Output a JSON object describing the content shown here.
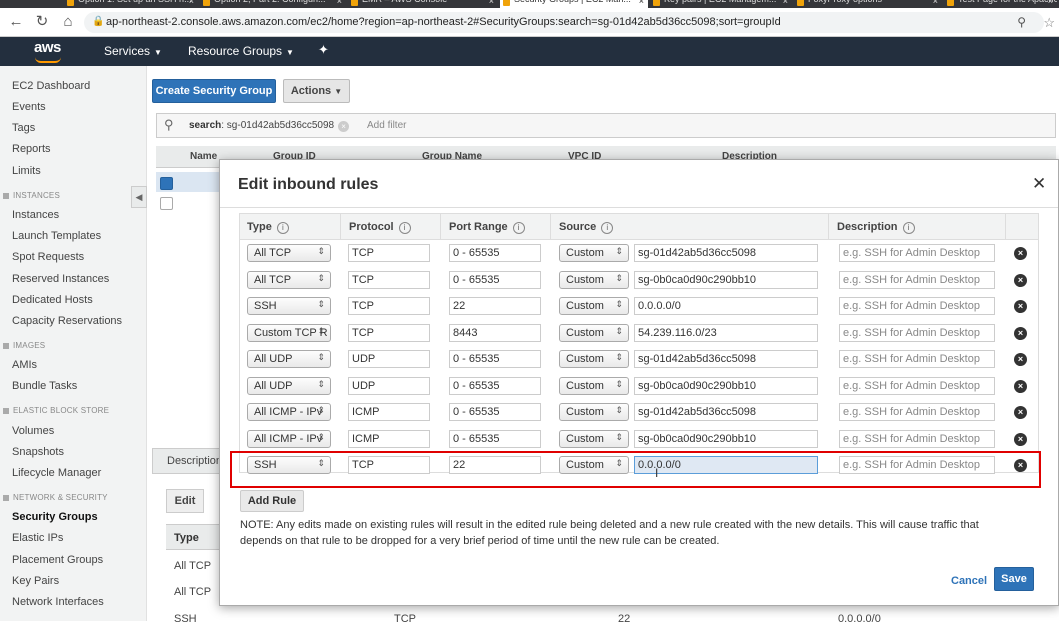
{
  "browser": {
    "tabs": [
      {
        "label": "Option 1: Set up an SSH h...",
        "active": false
      },
      {
        "label": "Option 2, Part 2: Configuri...",
        "active": false
      },
      {
        "label": "EMR – AWS Console",
        "active": false
      },
      {
        "label": "Security Groups | EC2 Man...",
        "active": true
      },
      {
        "label": "Key pairs | EC2 Managem...",
        "active": false
      },
      {
        "label": "FoxyProxy options",
        "active": false
      },
      {
        "label": "Test Page for the Apache",
        "active": false
      }
    ],
    "url": "ap-northeast-2.console.aws.amazon.com/ec2/home?region=ap-northeast-2#SecurityGroups:search=sg-01d42ab5d36cc5098;sort=groupId"
  },
  "aws_nav": {
    "logo": "aws",
    "services": "Services",
    "resource_groups": "Resource Groups"
  },
  "sidebar": {
    "items": [
      {
        "label": "EC2 Dashboard",
        "type": "item"
      },
      {
        "label": "Events",
        "type": "item"
      },
      {
        "label": "Tags",
        "type": "item"
      },
      {
        "label": "Reports",
        "type": "item"
      },
      {
        "label": "Limits",
        "type": "item"
      },
      {
        "label": "INSTANCES",
        "type": "head"
      },
      {
        "label": "Instances",
        "type": "item"
      },
      {
        "label": "Launch Templates",
        "type": "item"
      },
      {
        "label": "Spot Requests",
        "type": "item"
      },
      {
        "label": "Reserved Instances",
        "type": "item"
      },
      {
        "label": "Dedicated Hosts",
        "type": "item"
      },
      {
        "label": "Capacity Reservations",
        "type": "item"
      },
      {
        "label": "IMAGES",
        "type": "head"
      },
      {
        "label": "AMIs",
        "type": "item"
      },
      {
        "label": "Bundle Tasks",
        "type": "item"
      },
      {
        "label": "ELASTIC BLOCK STORE",
        "type": "head"
      },
      {
        "label": "Volumes",
        "type": "item"
      },
      {
        "label": "Snapshots",
        "type": "item"
      },
      {
        "label": "Lifecycle Manager",
        "type": "item"
      },
      {
        "label": "NETWORK & SECURITY",
        "type": "head"
      },
      {
        "label": "Security Groups",
        "type": "item",
        "active": true
      },
      {
        "label": "Elastic IPs",
        "type": "item"
      },
      {
        "label": "Placement Groups",
        "type": "item"
      },
      {
        "label": "Key Pairs",
        "type": "item"
      },
      {
        "label": "Network Interfaces",
        "type": "item"
      }
    ]
  },
  "main": {
    "create_button": "Create Security Group",
    "actions_button": "Actions",
    "search_token_key": "search",
    "search_token_value": ": sg-01d42ab5d36cc5098",
    "add_filter": "Add filter",
    "columns": [
      "Name",
      "Group ID",
      "Group Name",
      "VPC ID",
      "Description"
    ],
    "description_tab": "Description",
    "edit_button": "Edit",
    "lower_type_header": "Type",
    "lower_rows": [
      {
        "type": "All TCP"
      },
      {
        "type": "All TCP"
      },
      {
        "type": "SSH",
        "protocol": "TCP",
        "port": "22",
        "source": "0.0.0.0/0"
      }
    ]
  },
  "modal": {
    "title": "Edit inbound rules",
    "columns": {
      "type": "Type",
      "protocol": "Protocol",
      "port_range": "Port Range",
      "source": "Source",
      "description": "Description"
    },
    "rules": [
      {
        "type": "All TCP",
        "protocol": "TCP",
        "port": "0 - 65535",
        "source_type": "Custom",
        "source": "sg-01d42ab5d36cc5098",
        "description_placeholder": "e.g. SSH for Admin Desktop"
      },
      {
        "type": "All TCP",
        "protocol": "TCP",
        "port": "0 - 65535",
        "source_type": "Custom",
        "source": "sg-0b0ca0d90c290bb10",
        "description_placeholder": "e.g. SSH for Admin Desktop"
      },
      {
        "type": "SSH",
        "protocol": "TCP",
        "port": "22",
        "source_type": "Custom",
        "source": "0.0.0.0/0",
        "description_placeholder": "e.g. SSH for Admin Desktop"
      },
      {
        "type": "Custom TCP R",
        "protocol": "TCP",
        "port": "8443",
        "source_type": "Custom",
        "source": "54.239.116.0/23",
        "description_placeholder": "e.g. SSH for Admin Desktop"
      },
      {
        "type": "All UDP",
        "protocol": "UDP",
        "port": "0 - 65535",
        "source_type": "Custom",
        "source": "sg-01d42ab5d36cc5098",
        "description_placeholder": "e.g. SSH for Admin Desktop"
      },
      {
        "type": "All UDP",
        "protocol": "UDP",
        "port": "0 - 65535",
        "source_type": "Custom",
        "source": "sg-0b0ca0d90c290bb10",
        "description_placeholder": "e.g. SSH for Admin Desktop"
      },
      {
        "type": "All ICMP - IPv",
        "protocol": "ICMP",
        "port": "0 - 65535",
        "source_type": "Custom",
        "source": "sg-01d42ab5d36cc5098",
        "description_placeholder": "e.g. SSH for Admin Desktop"
      },
      {
        "type": "All ICMP - IPv",
        "protocol": "ICMP",
        "port": "0 - 65535",
        "source_type": "Custom",
        "source": "sg-0b0ca0d90c290bb10",
        "description_placeholder": "e.g. SSH for Admin Desktop"
      },
      {
        "type": "SSH",
        "protocol": "TCP",
        "port": "22",
        "source_type": "Custom",
        "source": "0.0.0.0/0",
        "description_placeholder": "e.g. SSH for Admin Desktop",
        "highlighted": true
      }
    ],
    "add_rule": "Add Rule",
    "note": "NOTE: Any edits made on existing rules will result in the edited rule being deleted and a new rule created with the new details. This will cause traffic that depends on that rule to be dropped for a very brief period of time until the new rule can be created.",
    "cancel": "Cancel",
    "save": "Save"
  },
  "colors": {
    "primary_blue": "#2e73b8",
    "aws_nav": "#232f3e",
    "aws_orange": "#ff9900",
    "highlight_red": "#e00000"
  }
}
